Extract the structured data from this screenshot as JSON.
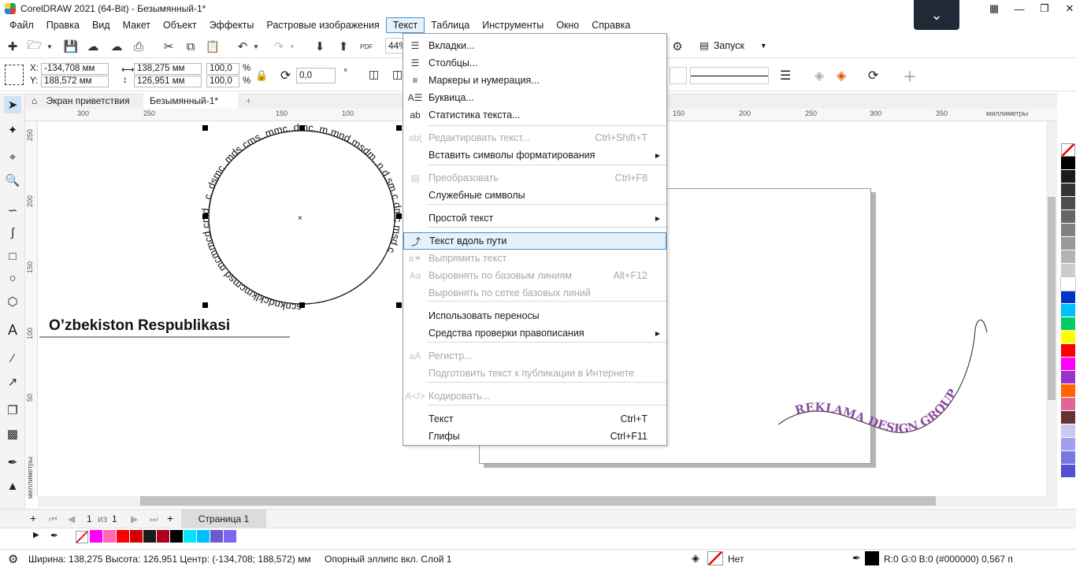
{
  "window": {
    "title": "CorelDRAW 2021 (64-Bit) - Безымянный-1*",
    "collapse_icon": "chevron-down-icon"
  },
  "menubar": [
    "Файл",
    "Правка",
    "Вид",
    "Макет",
    "Объект",
    "Эффекты",
    "Растровые изображения",
    "Текст",
    "Таблица",
    "Инструменты",
    "Окно",
    "Справка"
  ],
  "toolbar": {
    "zoom": "44%",
    "pdf_label": "PDF",
    "launch_label": "Запуск"
  },
  "propbar": {
    "x_label": "X:",
    "x_value": "-134,708 мм",
    "y_label": "Y:",
    "y_value": "188,572 мм",
    "width_value": "138,275 мм",
    "height_value": "126,951 мм",
    "scale_x": "100,0",
    "scale_y": "100,0",
    "percent": "%",
    "angle": "0,0",
    "angle_unit": "°"
  },
  "doctabs": {
    "welcome": "Экран приветствия",
    "doc": "Безымянный-1*",
    "add": "+"
  },
  "rulers": {
    "h_labels": [
      "300",
      "250",
      "150",
      "100",
      "150",
      "200",
      "250",
      "300",
      "350"
    ],
    "h_unit": "миллиметры",
    "v_labels": [
      "250",
      "200",
      "150",
      "100",
      "50"
    ],
    "v_unit": "миллиметры"
  },
  "canvas": {
    "circle_text": "scnkndcklkmcmsd mcmmcd cmd...c..dsmc..mds.cms..mmc..dmc..m.mnd.msdm..n.d.sm.c.dmc msd c",
    "heading": "O’zbekiston Respublikasi",
    "path_text": "REKLAMA DESIGN GROUP"
  },
  "text_menu": {
    "items": [
      {
        "label": "Вкладки...",
        "shortcut": "",
        "disabled": false,
        "icon": "tabs-icon"
      },
      {
        "label": "Столбцы...",
        "shortcut": "",
        "disabled": false,
        "icon": "columns-icon"
      },
      {
        "label": "Маркеры и нумерация...",
        "shortcut": "",
        "disabled": false,
        "icon": "bullets-icon"
      },
      {
        "label": "Буквица...",
        "shortcut": "",
        "disabled": false,
        "icon": "dropcap-icon"
      },
      {
        "label": "Статистика текста...",
        "shortcut": "",
        "disabled": false,
        "icon": "text-stats-icon"
      },
      {
        "label": "Редактировать текст...",
        "shortcut": "Ctrl+Shift+T",
        "disabled": true,
        "icon": "edit-text-icon"
      },
      {
        "label": "Вставить символы форматирования",
        "shortcut": "",
        "disabled": false,
        "submenu": true
      },
      {
        "label": "Преобразовать",
        "shortcut": "Ctrl+F8",
        "disabled": true,
        "icon": "convert-icon"
      },
      {
        "label": "Служебные символы",
        "shortcut": "",
        "disabled": false
      },
      {
        "label": "Простой текст",
        "shortcut": "",
        "disabled": false,
        "submenu": true
      },
      {
        "label": "Текст вдоль пути",
        "shortcut": "",
        "disabled": false,
        "icon": "text-on-path-icon",
        "highlighted": true
      },
      {
        "label": "Выпрямить текст",
        "shortcut": "",
        "disabled": true,
        "icon": "straighten-text-icon"
      },
      {
        "label": "Выровнять по базовым линиям",
        "shortcut": "Alt+F12",
        "disabled": true,
        "icon": "align-baseline-icon"
      },
      {
        "label": "Выровнять по сетке базовых линий",
        "shortcut": "",
        "disabled": true
      },
      {
        "label": "Использовать переносы",
        "shortcut": "",
        "disabled": false
      },
      {
        "label": "Средства проверки правописания",
        "shortcut": "",
        "disabled": false,
        "submenu": true
      },
      {
        "label": "Регистр...",
        "shortcut": "",
        "disabled": true,
        "icon": "case-icon"
      },
      {
        "label": "Подготовить текст к публикации в Интернете",
        "shortcut": "",
        "disabled": true
      },
      {
        "label": "Кодировать...",
        "shortcut": "",
        "disabled": true,
        "icon": "encode-icon"
      },
      {
        "label": "Текст",
        "shortcut": "Ctrl+T",
        "disabled": false
      },
      {
        "label": "Глифы",
        "shortcut": "Ctrl+F11",
        "disabled": false
      }
    ]
  },
  "pagenav": {
    "current": "1",
    "of": "из",
    "total": "1",
    "page_tab": "Страница 1"
  },
  "palette": {
    "right": [
      "#000000",
      "#1a1a1a",
      "#333333",
      "#4d4d4d",
      "#666666",
      "#808080",
      "#999999",
      "#b3b3b3",
      "#cccccc",
      "#ffffff",
      "#0033cc",
      "#00bfff",
      "#00cc66",
      "#ffff00",
      "#ff0000",
      "#ff00ff",
      "#9933cc",
      "#ff6600",
      "#e06699",
      "#663333",
      "#c8c8f0",
      "#a0a0ec",
      "#7878e0",
      "#5050d0"
    ],
    "bottom": [
      "#ff00ff",
      "#ff69b4",
      "#ff0000",
      "#d40000",
      "#1a1a1a",
      "#b00020",
      "#000000",
      "#00e5ff",
      "#00bfff",
      "#6a5acd",
      "#7b68ee"
    ]
  },
  "statusbar": {
    "dimensions": "Ширина: 138,275  Высота: 126,951  Центр: (-134,708; 188,572)  мм",
    "object_info": "Опорный эллипс вкл. Слой 1",
    "fill_label": "Нет",
    "outline_info": "R:0 G:0 B:0 (#000000)  0,567 п"
  }
}
